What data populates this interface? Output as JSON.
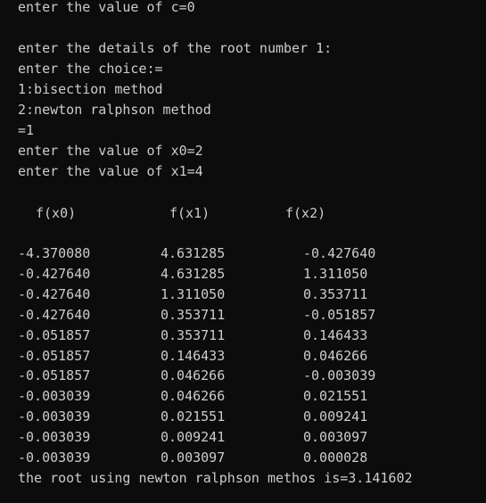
{
  "console": {
    "intro_lines": [
      "enter the value of c=0",
      "",
      "enter the details of the root number 1:",
      "enter the choice:=",
      "1:bisection method",
      "2:newton ralphson method",
      "=1",
      "enter the value of x0=2",
      "enter the value of x1=4"
    ],
    "table": {
      "headers": [
        "f(x0)",
        "f(x1)",
        "f(x2)"
      ],
      "rows": [
        [
          "-4.370080",
          "4.631285",
          "-0.427640"
        ],
        [
          "-0.427640",
          "4.631285",
          "1.311050"
        ],
        [
          "-0.427640",
          "1.311050",
          "0.353711"
        ],
        [
          "-0.427640",
          "0.353711",
          "-0.051857"
        ],
        [
          "-0.051857",
          "0.353711",
          "0.146433"
        ],
        [
          "-0.051857",
          "0.146433",
          "0.046266"
        ],
        [
          "-0.051857",
          "0.046266",
          "-0.003039"
        ],
        [
          "-0.003039",
          "0.046266",
          "0.021551"
        ],
        [
          "-0.003039",
          "0.021551",
          "0.009241"
        ],
        [
          "-0.003039",
          "0.009241",
          "0.003097"
        ],
        [
          "-0.003039",
          "0.003097",
          "0.000028"
        ]
      ]
    },
    "result_line": "the root using newton ralphson methos is=3.141602",
    "colors": {
      "background": "#0c0c0c",
      "text": "#cccccc"
    }
  }
}
